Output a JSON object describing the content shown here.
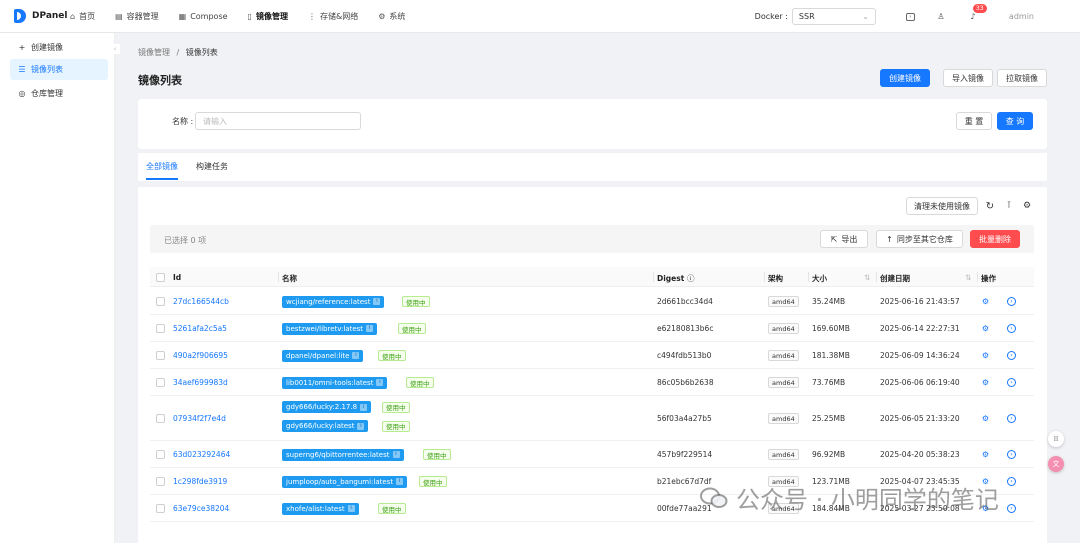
{
  "app": {
    "name": "DPanel"
  },
  "topnav": [
    {
      "label": "首页",
      "icon": "home-icon",
      "glyph": "⌂"
    },
    {
      "label": "容器管理",
      "icon": "container-icon",
      "glyph": "▤"
    },
    {
      "label": "Compose",
      "icon": "compose-icon",
      "glyph": "▦"
    },
    {
      "label": "镜像管理",
      "icon": "image-icon",
      "glyph": "▯"
    },
    {
      "label": "存储&网络",
      "icon": "storage-icon",
      "glyph": "⋮"
    },
    {
      "label": "系统",
      "icon": "gear-icon",
      "glyph": "⚙"
    }
  ],
  "header": {
    "docker_label": "Docker :",
    "docker_value": "SSR",
    "notification_count": "33",
    "username": "admin"
  },
  "sidebar": [
    {
      "label": "创建镜像",
      "glyph": "+"
    },
    {
      "label": "镜像列表",
      "glyph": "☰"
    },
    {
      "label": "仓库管理",
      "glyph": "◎"
    }
  ],
  "breadcrumb": {
    "parent": "镜像管理",
    "sep": "/",
    "current": "镜像列表"
  },
  "page": {
    "title": "镜像列表",
    "create_label": "创建镜像",
    "import_label": "导入镜像",
    "pull_label": "拉取镜像"
  },
  "filter": {
    "name_label": "名称 :",
    "name_placeholder": "请输入",
    "reset_label": "重 置",
    "query_label": "查 询"
  },
  "tabs": [
    "全部镜像",
    "构建任务"
  ],
  "toolbar": {
    "clean_label": "清理未使用镜像",
    "selected_text": "已选择 0 项",
    "export_label": "导出",
    "sync_label": "同步至其它仓库",
    "batch_delete_label": "批量删除"
  },
  "table": {
    "columns": [
      "Id",
      "名称",
      "Digest",
      "架构",
      "大小",
      "创建日期",
      "操作"
    ],
    "rows": [
      {
        "id": "27dc166544cb",
        "tags": [
          {
            "name": "wcjiang/reference:latest",
            "status": "使用中"
          }
        ],
        "digest": "2d661bcc34d4",
        "arch": "amd64",
        "size": "35.24MB",
        "created": "2025-06-16 21:43:57"
      },
      {
        "id": "5261afa2c5a5",
        "tags": [
          {
            "name": "bestzwei/libretv:latest",
            "status": "使用中"
          }
        ],
        "digest": "e62180813b6c",
        "arch": "amd64",
        "size": "169.60MB",
        "created": "2025-06-14 22:27:31"
      },
      {
        "id": "490a2f906695",
        "tags": [
          {
            "name": "dpanel/dpanel:lite",
            "status": "使用中"
          }
        ],
        "digest": "c494fdb513b0",
        "arch": "amd64",
        "size": "181.38MB",
        "created": "2025-06-09 14:36:24"
      },
      {
        "id": "34aef699983d",
        "tags": [
          {
            "name": "lib0011/omni-tools:latest",
            "status": "使用中"
          }
        ],
        "digest": "86c05b6b2638",
        "arch": "amd64",
        "size": "73.76MB",
        "created": "2025-06-06 06:19:40"
      },
      {
        "id": "07934f2f7e4d",
        "tags": [
          {
            "name": "gdy666/lucky:2.17.8",
            "status": "使用中"
          },
          {
            "name": "gdy666/lucky:latest",
            "status": "使用中"
          }
        ],
        "digest": "56f03a4a27b5",
        "arch": "amd64",
        "size": "25.25MB",
        "created": "2025-06-05 21:33:20"
      },
      {
        "id": "63d023292464",
        "tags": [
          {
            "name": "superng6/qbittorrentee:latest",
            "status": "使用中"
          }
        ],
        "digest": "457b9f229514",
        "arch": "amd64",
        "size": "96.92MB",
        "created": "2025-04-20 05:38:23"
      },
      {
        "id": "1c298fde3919",
        "tags": [
          {
            "name": "jumploop/auto_bangumi:latest",
            "status": "使用中"
          }
        ],
        "digest": "b21ebc67d7df",
        "arch": "amd64",
        "size": "123.71MB",
        "created": "2025-04-07 23:45:35"
      },
      {
        "id": "63e79ce38204",
        "tags": [
          {
            "name": "xhofe/alist:latest",
            "status": "使用中"
          }
        ],
        "digest": "00fde77aa291",
        "arch": "amd64",
        "size": "184.84MB",
        "created": "2025-03-27 23:50:08"
      }
    ]
  },
  "watermark": {
    "text": "公众号 · 小明同学的笔记"
  },
  "colors": {
    "primary": "#1677ff",
    "danger": "#ff4d4f",
    "tag": "#1e9bf0",
    "success": "#389e0d"
  }
}
